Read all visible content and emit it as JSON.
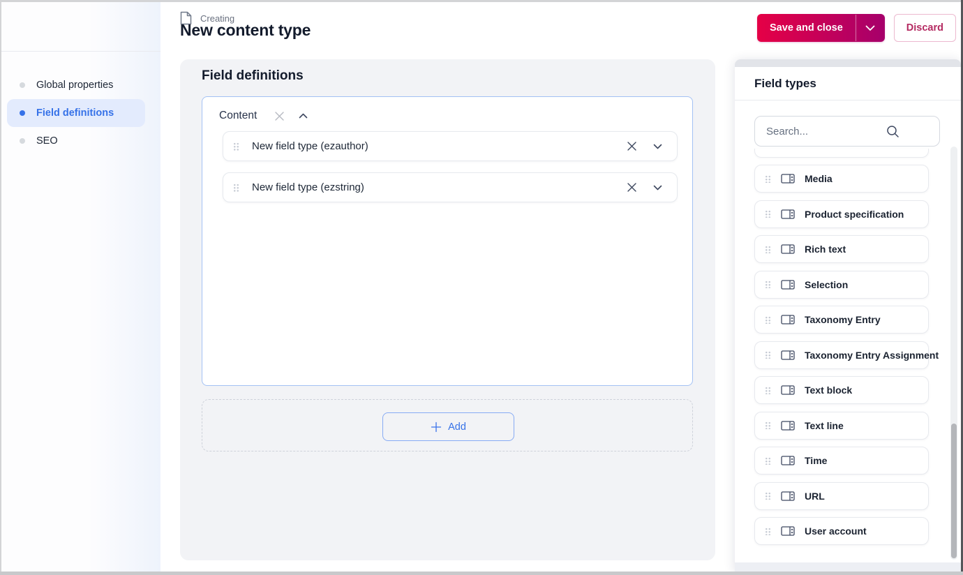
{
  "header": {
    "kicker": "Creating",
    "title": "New content type",
    "save_button_label": "Save and close",
    "discard_button_label": "Discard"
  },
  "sidebar": {
    "items": [
      {
        "label": "Global properties",
        "active": false
      },
      {
        "label": "Field definitions",
        "active": true
      },
      {
        "label": "SEO",
        "active": false
      }
    ]
  },
  "main": {
    "title": "Field definitions",
    "group": {
      "title": "Content",
      "fields": [
        {
          "label": "New field type (ezauthor)"
        },
        {
          "label": "New field type (ezstring)"
        }
      ]
    },
    "add_label": "Add"
  },
  "field_types": {
    "title": "Field types",
    "search_placeholder": "Search...",
    "items": [
      "Media",
      "Product specification",
      "Rich text",
      "Selection",
      "Taxonomy Entry",
      "Taxonomy Entry Assignment",
      "Text block",
      "Text line",
      "Time",
      "URL",
      "User account"
    ]
  },
  "colors": {
    "accent_blue": "#3672e8",
    "save_gradient_start": "#e50046",
    "save_gradient_end": "#a6006b",
    "discard_text": "#b42a61",
    "active_nav_bg": "#e3ebfd",
    "panel_bg": "#f2f3f6",
    "group_border": "#a3c1f4",
    "dark_text": "#131b2c"
  }
}
